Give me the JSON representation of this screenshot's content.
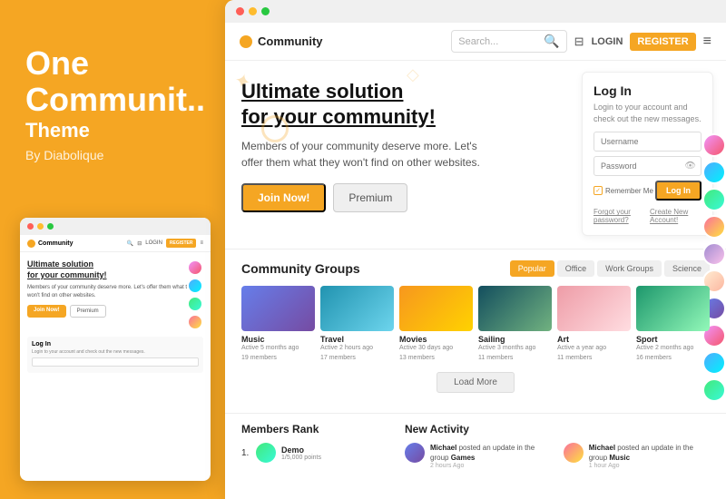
{
  "brand": {
    "title": "One",
    "subtitle": "Communit..",
    "theme": "Theme",
    "by": "By Diabolique"
  },
  "browser_bar": {
    "dots": [
      "red",
      "yellow",
      "green"
    ]
  },
  "nav": {
    "logo_text": "Community",
    "search_placeholder": "Search...",
    "login_label": "LOGIN",
    "register_label": "REGISTER"
  },
  "hero": {
    "title_line1": "Ultimate solution",
    "title_line2": "for your community!",
    "description": "Members of your community deserve more. Let's offer them what they won't find on other websites.",
    "join_btn": "Join Now!",
    "premium_btn": "Premium"
  },
  "login_box": {
    "title": "Log In",
    "description": "Login to your account and check out the new messages.",
    "username_placeholder": "Username",
    "password_placeholder": "Password",
    "remember_me": "Remember Me",
    "login_btn": "Log In",
    "forgot_password": "Forgot your password?",
    "create_account": "Create New Account!"
  },
  "groups_section": {
    "title": "Community Groups",
    "filters": [
      "Popular",
      "Office",
      "Work Groups",
      "Science"
    ],
    "active_filter": "Popular",
    "load_more": "Load More",
    "groups": [
      {
        "name": "Music",
        "active": "Active 5 months ago",
        "members": "19 members",
        "color_class": "gi-music"
      },
      {
        "name": "Travel",
        "active": "Active 2 hours ago",
        "members": "17 members",
        "color_class": "gi-travel"
      },
      {
        "name": "Movies",
        "active": "Active 30 days ago",
        "members": "13 members",
        "color_class": "gi-movies"
      },
      {
        "name": "Sailing",
        "active": "Active 3 months ago",
        "members": "11 members",
        "color_class": "gi-sailing"
      },
      {
        "name": "Art",
        "active": "Active a year ago",
        "members": "11 members",
        "color_class": "gi-art"
      },
      {
        "name": "Sport",
        "active": "Active 2 months ago",
        "members": "16 members",
        "color_class": "gi-sport"
      }
    ]
  },
  "members_rank": {
    "title": "Members Rank",
    "members": [
      {
        "rank": "1.",
        "name": "Demo",
        "points": "1/5,000 points"
      }
    ]
  },
  "new_activity": {
    "title": "New Activity",
    "items": [
      {
        "user": "Michael",
        "action": "posted an update in the group",
        "target": "Games",
        "time": "2 hours Ago"
      },
      {
        "user": "Michael",
        "action": "posted an update in the group",
        "target": "Music",
        "time": "1 hour Ago"
      }
    ]
  }
}
